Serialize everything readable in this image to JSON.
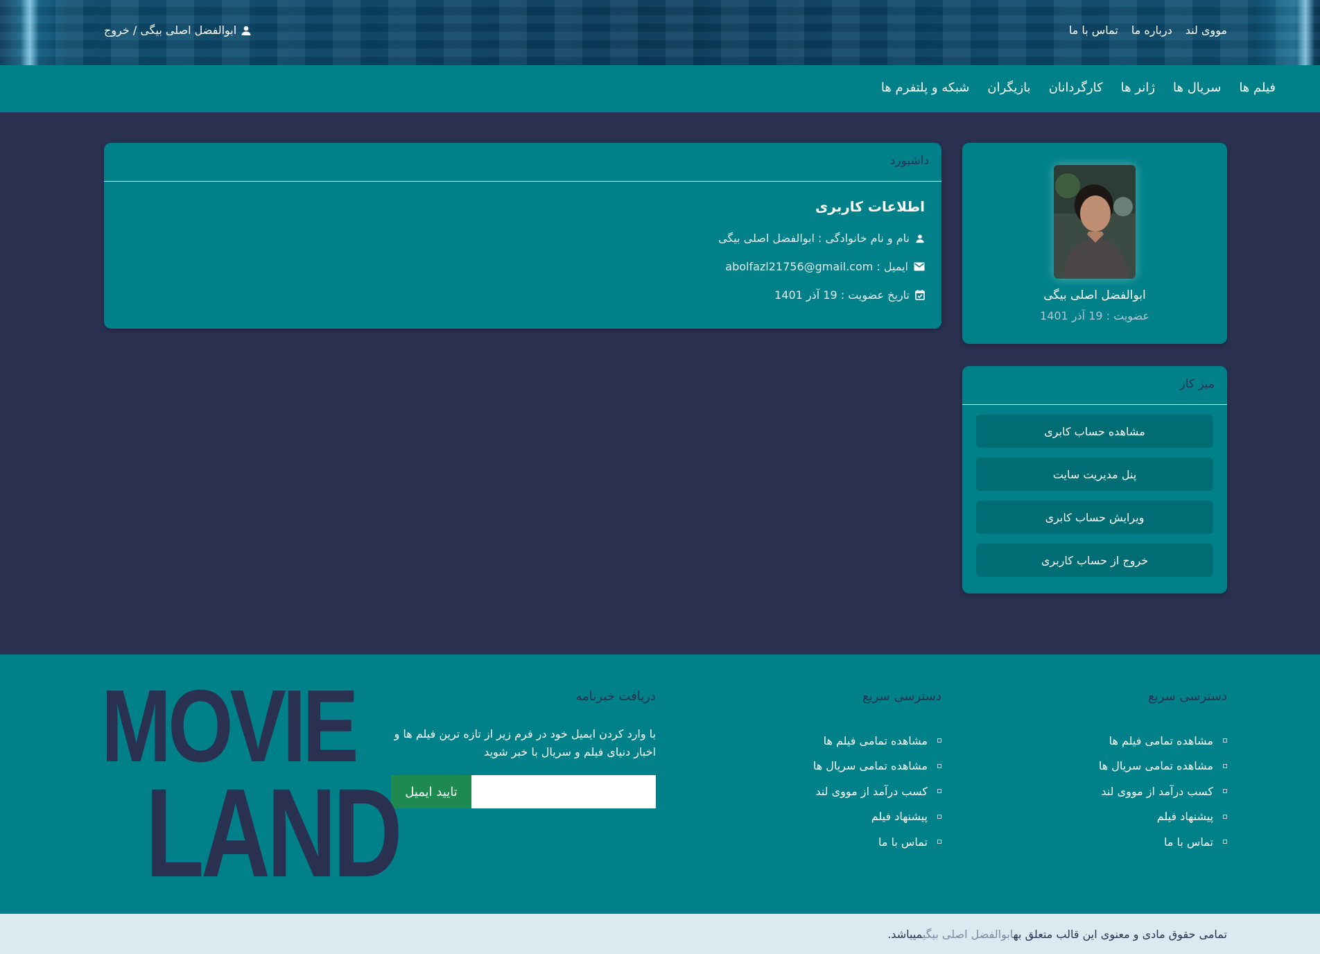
{
  "topbar": {
    "nav": [
      "مووی لند",
      "درباره ما",
      "تماس با ما"
    ],
    "user_label": "ابوالفضل اصلی بیگی / خروج"
  },
  "mainnav": {
    "items": [
      "فیلم ها",
      "سریال ها",
      "ژانر ها",
      "کارگردانان",
      "بازیگران",
      "شبکه و پلتفرم ها"
    ]
  },
  "profile": {
    "name": "ابوالفضل اصلی بیگی",
    "membership": "عضویت : 19 آذر 1401"
  },
  "desk": {
    "title": "میز کار",
    "buttons": [
      "مشاهده حساب کابری",
      "پنل مدیریت سایت",
      "ویرایش حساب کابری",
      "خروج از حساب کاربری"
    ]
  },
  "dashboard": {
    "title": "داشبورد",
    "section_title": "اطلاعات کاربری",
    "fullname": "نام و نام خانوادگی : ابوالفضل اصلی بیگی",
    "email": "ایمیل : abolfazl21756@gmail.com",
    "joined": "تاریخ عضویت : 19 آذر 1401"
  },
  "footer": {
    "col1": {
      "title": "دسترسی سریع",
      "links": [
        "مشاهده تمامی فیلم ها",
        "مشاهده تمامی سریال ها",
        "کسب درآمد از مووی لند",
        "پیشنهاد فیلم",
        "تماس با ما"
      ]
    },
    "col2": {
      "title": "دسترسی سریع",
      "links": [
        "مشاهده تمامی فیلم ها",
        "مشاهده تمامی سریال ها",
        "کسب درآمد از مووی لند",
        "پیشنهاد فیلم",
        "تماس با ما"
      ]
    },
    "newsletter": {
      "title": "دریافت خبرنامه",
      "description": "با وارد کردن ایمیل خود در فرم زیر از تازه ترین فیلم ها و اخبار دنیای فیلم و سریال با خبر شوید",
      "input_value": "",
      "button": "تایید ایمیل"
    },
    "logo": {
      "line1": "MOVIE",
      "line2": "LAND"
    }
  },
  "copyright": {
    "prefix": "تمامی حقوق مادی و معنوی این قالب متعلق به",
    "owner": "ابوالفضل اصلی بیگی",
    "suffix": "میباشد."
  },
  "colors": {
    "background": "#2a3150",
    "accent": "#00818a",
    "button": "#006d75",
    "newsletter_button": "#1e8a4f",
    "copyright_bg": "#dbeaf1"
  }
}
